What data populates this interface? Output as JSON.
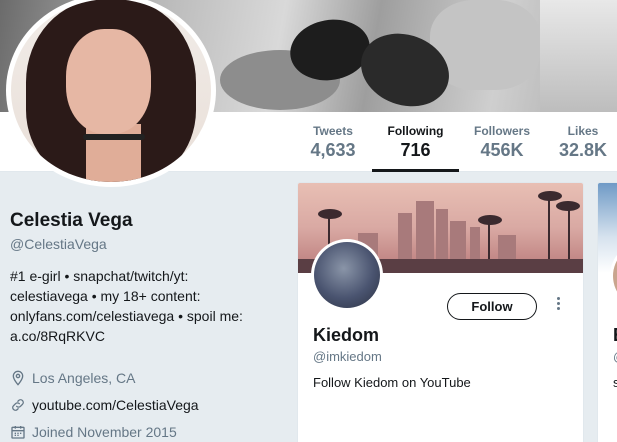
{
  "profile": {
    "name": "Celestia Vega",
    "handle": "@CelestiaVega",
    "bio_lines": [
      "#1 e-girl • snapchat/twitch/yt:",
      "celestiavega • my 18+ content:",
      "onlyfans.com/celestiavega • spoil me:",
      "a.co/8RqRKVC"
    ],
    "location": "Los Angeles, CA",
    "location_icon": "map-pin-icon",
    "website": "youtube.com/CelestiaVega",
    "website_icon": "link-icon",
    "joined": "Joined November 2015",
    "joined_icon": "calendar-icon"
  },
  "stats": {
    "tweets_label": "Tweets",
    "tweets_value": "4,633",
    "following_label": "Following",
    "following_value": "716",
    "followers_label": "Followers",
    "followers_value": "456K",
    "likes_label": "Likes",
    "likes_value": "32.8K",
    "active_tab": "Following"
  },
  "cards": [
    {
      "name": "Kiedom",
      "handle": "@imkiedom",
      "description": "Follow Kiedom on YouTube",
      "follow_label": "Follow",
      "more_icon": "more-vertical-icon"
    },
    {
      "name": "E",
      "handle": "@",
      "description": "s"
    }
  ],
  "colors": {
    "page_background": "#e6ecf0",
    "text_primary": "#14171a",
    "text_secondary": "#657786",
    "divider": "#e1e8ed"
  }
}
